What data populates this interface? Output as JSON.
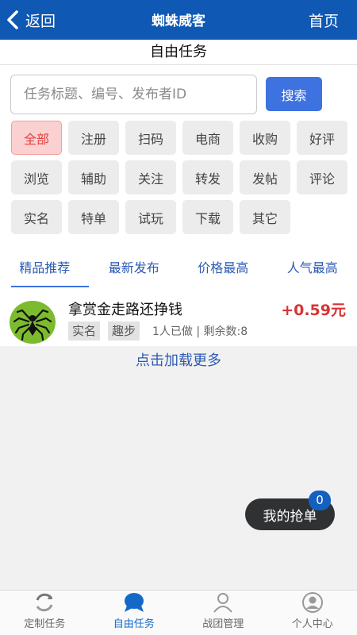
{
  "header": {
    "back_label": "返回",
    "title": "蜘蛛威客",
    "home_label": "首页"
  },
  "subheader": {
    "title": "自由任务"
  },
  "search": {
    "placeholder": "任务标题、编号、发布者ID",
    "button_label": "搜索"
  },
  "tags": [
    "全部",
    "注册",
    "扫码",
    "电商",
    "收购",
    "好评",
    "浏览",
    "辅助",
    "关注",
    "转发",
    "发帖",
    "评论",
    "实名",
    "特单",
    "试玩",
    "下载",
    "其它"
  ],
  "active_tag": "全部",
  "tabs": [
    "精品推荐",
    "最新发布",
    "价格最高",
    "人气最高"
  ],
  "active_tab": "精品推荐",
  "tasks": [
    {
      "title": "拿赏金走路还挣钱",
      "price": "+0.59元",
      "badges": [
        "实名",
        "趣步"
      ],
      "meta": "1人已做 | 剩余数:8",
      "avatar_icon": "spider-icon"
    }
  ],
  "load_more_label": "点击加载更多",
  "floating": {
    "label": "我的抢单",
    "count": "0"
  },
  "bottom_nav": [
    {
      "label": "定制任务",
      "icon": "refresh-icon"
    },
    {
      "label": "自由任务",
      "icon": "chat-bubble-icon"
    },
    {
      "label": "战团管理",
      "icon": "person-outline-icon"
    },
    {
      "label": "个人中心",
      "icon": "user-circle-icon"
    }
  ],
  "colors": {
    "primary": "#0f58b4",
    "accent": "#3d72e0",
    "price": "#d93333",
    "active_tag_bg": "#fbd0d0"
  }
}
